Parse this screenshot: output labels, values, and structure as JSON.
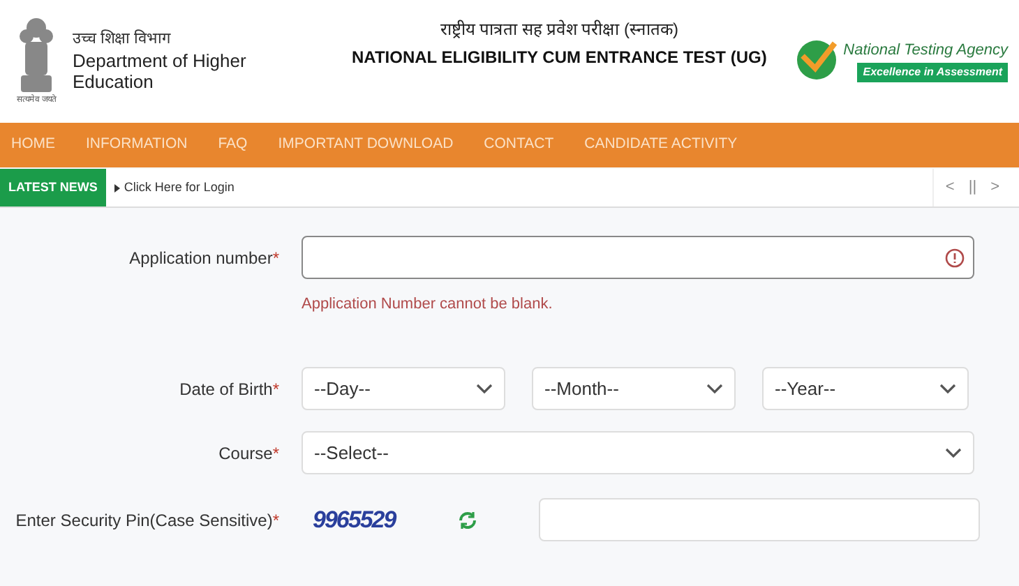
{
  "header": {
    "emblem_caption": "सत्यमेव जयते",
    "department_hindi": "उच्च शिक्षा विभाग",
    "department": "Department of Higher Education",
    "title_hindi": "राष्ट्रीय पात्रता सह प्रवेश परीक्षा (स्नातक)",
    "title": "NATIONAL ELIGIBILITY CUM ENTRANCE TEST (UG)",
    "agency": "National Testing Agency",
    "agency_tagline": "Excellence in Assessment"
  },
  "nav": [
    "HOME",
    "INFORMATION",
    "FAQ",
    "IMPORTANT DOWNLOAD",
    "CONTACT",
    "CANDIDATE ACTIVITY"
  ],
  "news": {
    "label": "LATEST NEWS",
    "item": "Click Here for Login",
    "controls": [
      "<",
      "||",
      ">"
    ]
  },
  "form": {
    "application": {
      "label": "Application number",
      "required": "*",
      "error": "Application Number cannot be blank."
    },
    "dob": {
      "label": "Date of Birth",
      "required": "*",
      "selects": [
        "--Day--",
        "--Month--",
        "--Year--"
      ]
    },
    "course": {
      "label": "Course",
      "required": "*",
      "select": "--Select--"
    },
    "pin": {
      "label": "Enter Security Pin(Case Sensitive)",
      "required": "*",
      "captcha": "9965529"
    }
  }
}
